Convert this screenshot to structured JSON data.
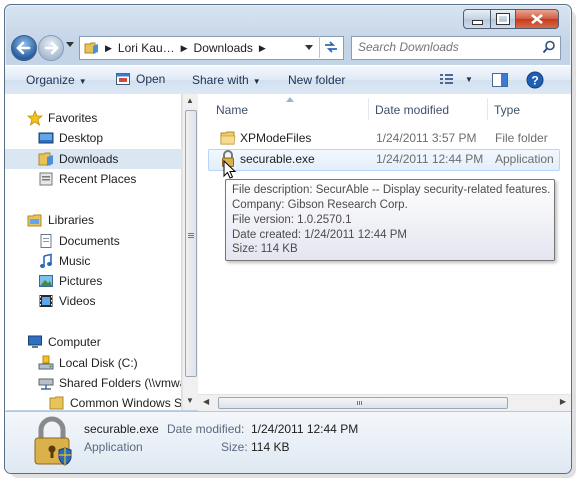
{
  "address": {
    "crumbs": [
      "Lori Kau…",
      "Downloads"
    ]
  },
  "search": {
    "placeholder": "Search Downloads"
  },
  "toolbar": {
    "organize": "Organize",
    "open": "Open",
    "share_with": "Share with",
    "new_folder": "New folder"
  },
  "nav": {
    "favorites": "Favorites",
    "desktop": "Desktop",
    "downloads": "Downloads",
    "recent_places": "Recent Places",
    "libraries": "Libraries",
    "documents": "Documents",
    "music": "Music",
    "pictures": "Pictures",
    "videos": "Videos",
    "computer": "Computer",
    "local_disk": "Local Disk (C:)",
    "shared_folders": "Shared Folders (\\\\vmwa",
    "common_windows": "Common Windows Sl"
  },
  "columns": {
    "name": "Name",
    "date_modified": "Date modified",
    "type": "Type"
  },
  "files": [
    {
      "name": "XPModeFiles",
      "date": "1/24/2011 3:57 PM",
      "type": "File folder"
    },
    {
      "name": "securable.exe",
      "date": "1/24/2011 12:44 PM",
      "type": "Application"
    }
  ],
  "tooltip": {
    "description": "File description: SecurAble -- Display security-related features.",
    "company": "Company: Gibson Research Corp.",
    "version": "File version: 1.0.2570.1",
    "created": "Date created: 1/24/2011 12:44 PM",
    "size": "Size: 114 KB"
  },
  "details": {
    "filename": "securable.exe",
    "date_label": "Date modified:",
    "date_value": "1/24/2011 12:44 PM",
    "type": "Application",
    "size_label": "Size:",
    "size_value": "114 KB"
  }
}
